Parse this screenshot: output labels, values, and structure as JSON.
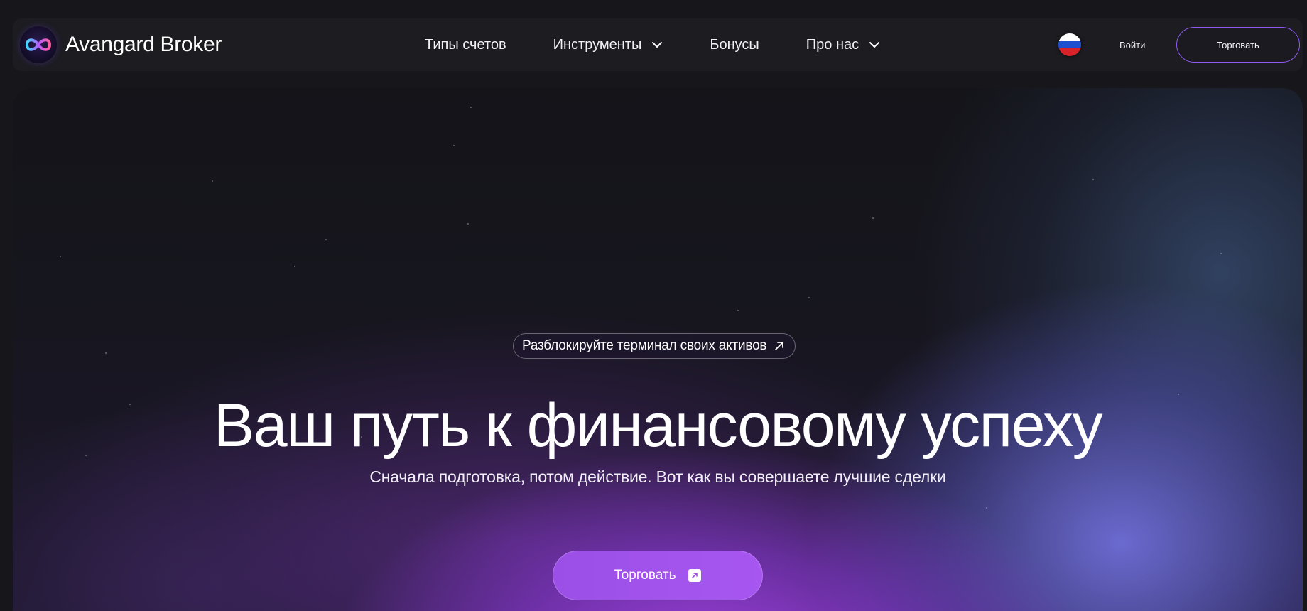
{
  "header": {
    "brand": "Avangard Broker",
    "nav": [
      {
        "label": "Типы счетов",
        "has_dropdown": false
      },
      {
        "label": "Инструменты",
        "has_dropdown": true
      },
      {
        "label": "Бонусы",
        "has_dropdown": false
      },
      {
        "label": "Про нас",
        "has_dropdown": true
      }
    ],
    "language_icon": "russian-flag-icon",
    "login_label": "Войти",
    "trade_label": "Торговать"
  },
  "hero": {
    "pill_text": "Разблокируйте терминал своих активов",
    "headline": "Ваш путь к финансовому успеху",
    "subheadline": "Сначала подготовка, потом действие. Вот как вы совершаете лучшие сделки",
    "cta_label": "Торговать",
    "cta_icon": "arrow-up-right-icon"
  },
  "colors": {
    "background": "#16161b",
    "header_bg": "#1c1c21",
    "accent_purple": "#a757f0",
    "outline_purple": "#8f5bf0"
  }
}
